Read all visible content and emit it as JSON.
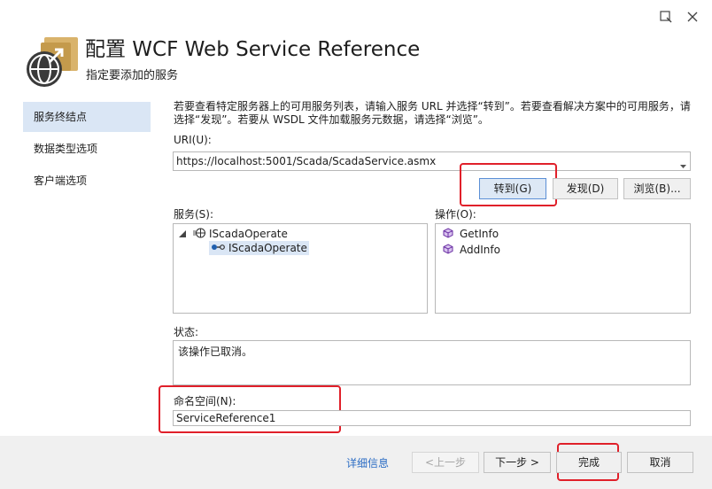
{
  "window": {
    "title": "配置 WCF Web Service Reference",
    "subtitle": "指定要添加的服务"
  },
  "sidebar": {
    "items": [
      {
        "label": "服务终结点",
        "active": true
      },
      {
        "label": "数据类型选项",
        "active": false
      },
      {
        "label": "客户端选项",
        "active": false
      }
    ]
  },
  "main": {
    "description": "若要查看特定服务器上的可用服务列表，请输入服务 URL 并选择“转到”。若要查看解决方案中的可用服务，请选择“发现”。若要从 WSDL 文件加载服务元数据，请选择“浏览”。",
    "uri_label": "URI(U):",
    "uri_value": "https://localhost:5001/Scada/ScadaService.asmx",
    "buttons": {
      "go": "转到(G)",
      "discover": "发现(D)",
      "browse": "浏览(B)..."
    },
    "services_label": "服务(S):",
    "services_tree": {
      "parent": "IScadaOperate",
      "child": "IScadaOperate"
    },
    "operations_label": "操作(O):",
    "operations": [
      "GetInfo",
      "AddInfo"
    ],
    "status_label": "状态:",
    "status_text": "该操作已取消。",
    "namespace_label": "命名空间(N):",
    "namespace_value": "ServiceReference1"
  },
  "footer": {
    "details_link": "详细信息",
    "prev": "<上一步",
    "next": "下一步 >",
    "finish": "完成",
    "cancel": "取消"
  },
  "colors": {
    "accent": "#2b6cc4",
    "highlight_box": "#e0202a",
    "selected": "#dae6f5"
  }
}
